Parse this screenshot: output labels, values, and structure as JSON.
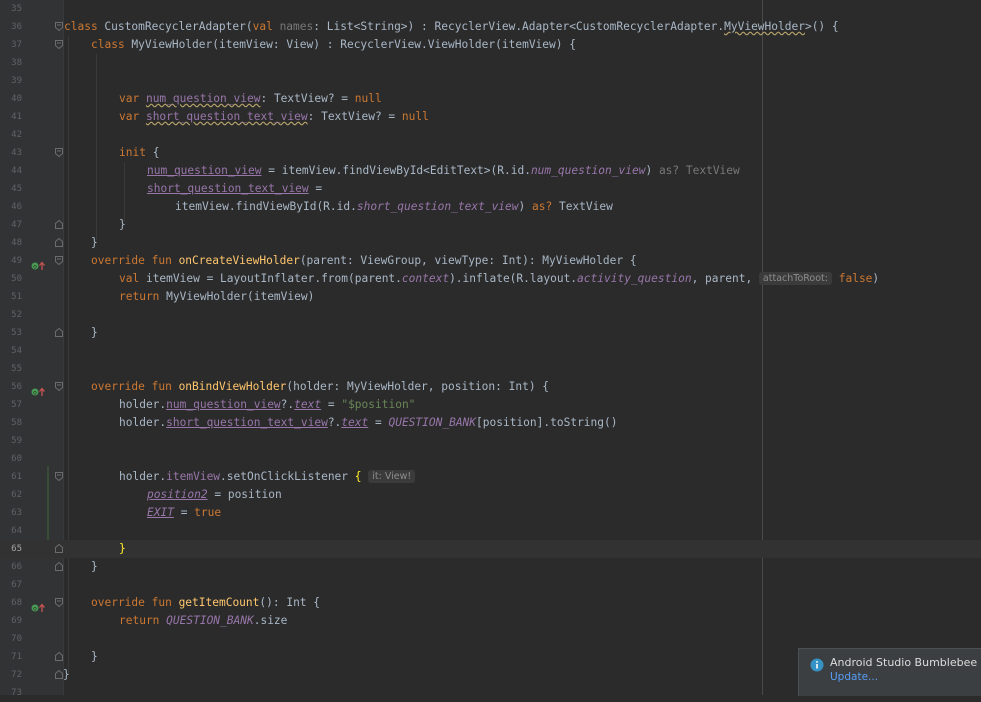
{
  "editor": {
    "lines": {
      "l35": "35",
      "l36": "36",
      "l37": "37",
      "l38": "38",
      "l39": "39",
      "l40": "40",
      "l41": "41",
      "l42": "42",
      "l43": "43",
      "l44": "44",
      "l45": "45",
      "l46": "46",
      "l47": "47",
      "l48": "48",
      "l49": "49",
      "l50": "50",
      "l51": "51",
      "l52": "52",
      "l53": "53",
      "l54": "54",
      "l55": "55",
      "l56": "56",
      "l57": "57",
      "l58": "58",
      "l59": "59",
      "l60": "60",
      "l61": "61",
      "l62": "62",
      "l63": "63",
      "l64": "64",
      "l65": "65",
      "l66": "66",
      "l67": "67",
      "l68": "68",
      "l69": "69",
      "l70": "70",
      "l71": "71",
      "l72": "72",
      "l73": "73"
    },
    "code": {
      "c36": {
        "a": "class ",
        "b": "CustomRecyclerAdapter(",
        "c": "val ",
        "d": "names",
        "e": ": List<String>) : RecyclerView.Adapter<CustomRecyclerAdapter.",
        "f": "MyViewHolder",
        "g": ">() {"
      },
      "c37": {
        "a": "class ",
        "b": "MyViewHolder(itemView: View) : RecyclerView.ViewHolder(itemView) {"
      },
      "c40": {
        "a": "var ",
        "b": "num_question_view",
        "c": ": TextView? = ",
        "d": "null"
      },
      "c41": {
        "a": "var ",
        "b": "short_question_text_view",
        "c": ": TextView? = ",
        "d": "null"
      },
      "c43": {
        "a": "init ",
        "b": "{"
      },
      "c44": {
        "a": "num_question_view",
        "b": " = itemView.findViewById<EditText>(R.id.",
        "c": "num_question_view",
        "d": ") ",
        "e": "as? TextView"
      },
      "c45": {
        "a": "short_question_text_view",
        "b": " ="
      },
      "c46": {
        "a": "itemView.findViewById(R.id.",
        "b": "short_question_text_view",
        "c": ") ",
        "d": "as? ",
        "e": "TextView"
      },
      "c47": "}",
      "c48": "}",
      "c49": {
        "a": "override fun ",
        "b": "onCreateViewHolder",
        "c": "(parent: ViewGroup, viewType: Int): MyViewHolder {"
      },
      "c50": {
        "a": "val ",
        "b": "itemView = LayoutInflater.from(parent.",
        "c": "context",
        "d": ").inflate(R.layout.",
        "e": "activity_question",
        "f": ", parent, ",
        "g": "attachToRoot:",
        "h": "false",
        "i": ")"
      },
      "c51": {
        "a": "return ",
        "b": "MyViewHolder(itemView)"
      },
      "c53": "}",
      "c56": {
        "a": "override fun ",
        "b": "onBindViewHolder",
        "c": "(holder: MyViewHolder, position: Int) {"
      },
      "c57": {
        "a": "holder.",
        "b": "num_question_view",
        "c": "?.",
        "d": "text",
        "e": " = ",
        "f": "\"$position\""
      },
      "c58": {
        "a": "holder.",
        "b": "short_question_text_view",
        "c": "?.",
        "d": "text",
        "e": " = ",
        "f": "QUESTION_BANK",
        "g": "[position].toString()"
      },
      "c61": {
        "a": "holder.",
        "b": "itemView",
        "c": ".setOnClickListener ",
        "d": "{",
        "e": "it: View!"
      },
      "c62": {
        "a": "position2",
        "b": " = position"
      },
      "c63": {
        "a": "EXIT",
        "b": " = ",
        "c": "true"
      },
      "c65": "}",
      "c66": "}",
      "c68": {
        "a": "override fun ",
        "b": "getItemCount",
        "c": "(): Int {"
      },
      "c69": {
        "a": "return ",
        "b": "QUESTION_BANK",
        "c": ".size"
      },
      "c71": "}",
      "c72": "}"
    }
  },
  "notification": {
    "title": "Android Studio Bumblebee",
    "link": "Update..."
  },
  "colors": {
    "background": "#2b2b2b",
    "gutter": "#313335",
    "keyword": "#cc7832",
    "function": "#ffc66d",
    "string": "#6a8759",
    "property": "#9876aa",
    "text": "#a9b7c6"
  }
}
